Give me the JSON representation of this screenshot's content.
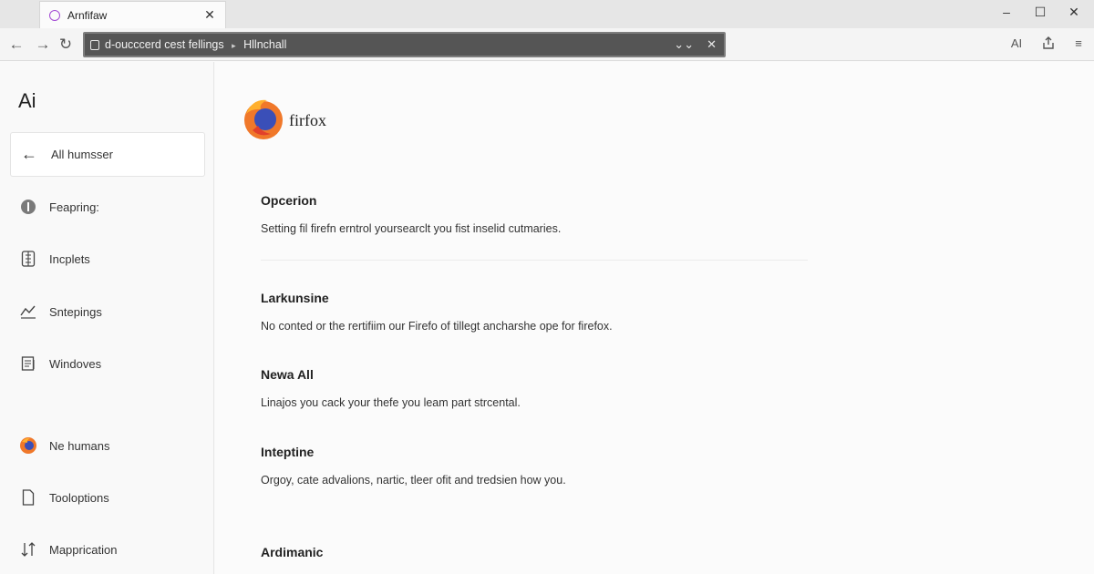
{
  "browser": {
    "tab": {
      "title": "Arnfifaw"
    },
    "url": {
      "left": "d-oucccerd cest fellings",
      "separator": "▸",
      "right": "Hllnchall"
    },
    "toolbar_right": {
      "ai_label": "AI"
    }
  },
  "sidebar": {
    "brand": "Ai",
    "back_label": "All humsser",
    "items": [
      {
        "label": "Feapring:",
        "icon": "info-circle-icon"
      },
      {
        "label": "Incplets",
        "icon": "notebook-icon"
      },
      {
        "label": "Sntepings",
        "icon": "trend-line-icon"
      },
      {
        "label": "Windoves",
        "icon": "windows-icon"
      },
      {
        "label": "Ne humans",
        "icon": "firefox-icon"
      },
      {
        "label": "Tooloptions",
        "icon": "document-icon"
      },
      {
        "label": "Mapprication",
        "icon": "sort-arrows-icon"
      }
    ]
  },
  "main": {
    "brand_name": "firfox",
    "sections": [
      {
        "title": "Opcerion",
        "desc": "Setting fil firefn erntrol yoursearclt you fist inselid cutmaries."
      },
      {
        "title": "Larkunsine",
        "desc": "No conted or the rertifiim our Firefo of tillegt ancharshe ope for firefox."
      },
      {
        "title": "Newa All",
        "desc": "Linajos you cack your thefe you leam part strcental."
      },
      {
        "title": "Inteptine",
        "desc": "Orgoy, cate advalions, nartic, tleer ofit and tredsien how you."
      },
      {
        "title": "Ardimanic",
        "desc": ""
      }
    ]
  },
  "colors": {
    "accent_orange": "#f0782a",
    "firefox_blue": "#3a4fb8",
    "urlbar_bg": "#555555"
  }
}
